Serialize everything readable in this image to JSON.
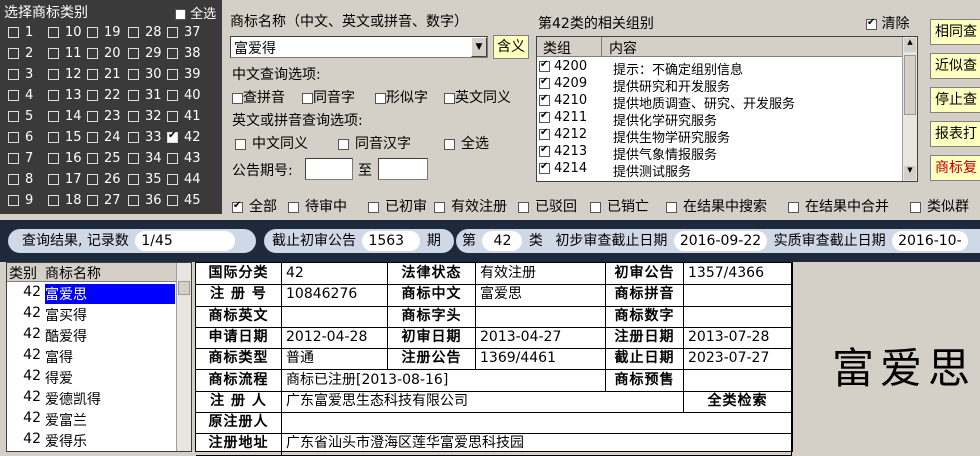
{
  "category_panel": {
    "title": "选择商标类别",
    "select_all": "全选",
    "selected": [
      42
    ],
    "rows": [
      [
        1,
        10,
        19,
        28,
        37
      ],
      [
        2,
        11,
        20,
        29,
        38
      ],
      [
        3,
        12,
        21,
        30,
        39
      ],
      [
        4,
        13,
        22,
        31,
        40
      ],
      [
        5,
        14,
        23,
        32,
        41
      ],
      [
        6,
        15,
        24,
        33,
        42
      ],
      [
        7,
        16,
        25,
        34,
        43
      ],
      [
        8,
        17,
        26,
        35,
        44
      ],
      [
        9,
        18,
        27,
        36,
        45
      ]
    ]
  },
  "search": {
    "name_label": "商标名称（中文、英文或拼音、数字）",
    "name_value": "富爱得",
    "contains_button": "含义",
    "cn_options_label": "中文查询选项:",
    "cn_options": [
      "查拼音",
      "同音字",
      "形似字",
      "英文同义"
    ],
    "en_options_label": "英文或拼音查询选项:",
    "en_options": [
      "中文同义",
      "同音汉字",
      "全选"
    ],
    "gazette_label": "公告期号:",
    "gazette_to": "至"
  },
  "groups": {
    "title": "第42类的相关组别",
    "clear_label": "清除",
    "col_group": "类组",
    "col_content": "内容",
    "rows": [
      {
        "code": "4200",
        "text": "提示：不确定组别信息"
      },
      {
        "code": "4209",
        "text": "提供研究和开发服务"
      },
      {
        "code": "4210",
        "text": "提供地质调查、研究、开发服务"
      },
      {
        "code": "4211",
        "text": "提供化学研究服务"
      },
      {
        "code": "4212",
        "text": "提供生物学研究服务"
      },
      {
        "code": "4213",
        "text": "提供气象情报服务"
      },
      {
        "code": "4214",
        "text": "提供测试服务"
      }
    ]
  },
  "side_buttons": [
    "相同查",
    "近似查",
    "停止查",
    "报表打",
    "商标复"
  ],
  "filters": [
    {
      "label": "全部",
      "checked": true
    },
    {
      "label": "待审中",
      "checked": false
    },
    {
      "label": "已初审",
      "checked": false
    },
    {
      "label": "有效注册",
      "checked": false
    },
    {
      "label": "已驳回",
      "checked": false
    },
    {
      "label": "已销亡",
      "checked": false
    },
    {
      "label": "在结果中搜索",
      "checked": false
    },
    {
      "label": "在结果中合并",
      "checked": false
    },
    {
      "label": "类似群",
      "checked": false
    }
  ],
  "status": {
    "result_label": "查询结果, 记录数",
    "result_value": "1/45",
    "deadline_label": "截止初审公告",
    "deadline_value": "1563",
    "deadline_unit": "期",
    "class_prefix": "第",
    "class_value": "42",
    "class_suffix": "类",
    "prelim_label": "初步审查截止日期",
    "prelim_value": "2016-09-22",
    "substantive_label": "实质审查截止日期",
    "substantive_value": "2016-10-"
  },
  "results": {
    "col_class": "类别",
    "col_name": "商标名称",
    "selected_index": 0,
    "rows": [
      {
        "cls": "42",
        "name": "富爱思"
      },
      {
        "cls": "42",
        "name": "富买得"
      },
      {
        "cls": "42",
        "name": "酷爱得"
      },
      {
        "cls": "42",
        "name": "富得"
      },
      {
        "cls": "42",
        "name": "得爱"
      },
      {
        "cls": "42",
        "name": "爱德凯得"
      },
      {
        "cls": "42",
        "name": "爱富兰"
      },
      {
        "cls": "42",
        "name": "爱得乐"
      }
    ]
  },
  "detail": {
    "intl_class_k": "国际分类",
    "intl_class_v": "42",
    "legal_status_k": "法律状态",
    "legal_status_v": "有效注册",
    "prelim_pub_k": "初审公告",
    "prelim_pub_v": "1357/4366",
    "reg_no_k": "注 册 号",
    "reg_no_v": "10846276",
    "mark_cn_k": "商标中文",
    "mark_cn_v": "富爱思",
    "mark_py_k": "商标拼音",
    "mark_py_v": "",
    "mark_en_k": "商标英文",
    "mark_en_v": "",
    "mark_initial_k": "商标字头",
    "mark_initial_v": "",
    "mark_num_k": "商标数字",
    "mark_num_v": "",
    "apply_date_k": "申请日期",
    "apply_date_v": "2012-04-28",
    "prelim_date_k": "初审日期",
    "prelim_date_v": "2013-04-27",
    "reg_date_k": "注册日期",
    "reg_date_v": "2013-07-28",
    "mark_type_k": "商标类型",
    "mark_type_v": "普通",
    "reg_pub_k": "注册公告",
    "reg_pub_v": "1369/4461",
    "expiry_k": "截止日期",
    "expiry_v": "2023-07-27",
    "flow_k": "商标流程",
    "flow_v": "商标已注册[2013-08-16]",
    "preview_k": "商标预售",
    "preview_v": "",
    "registrant_k": "注 册 人",
    "registrant_v": "广东富爱思生态科技有限公司",
    "all_class_search": "全类检索",
    "orig_registrant_k": "原注册人",
    "orig_registrant_v": "",
    "address_k": "注册地址",
    "address_v": "广东省汕头市澄海区莲华富爱思科技园"
  },
  "big_name": "富爱思"
}
